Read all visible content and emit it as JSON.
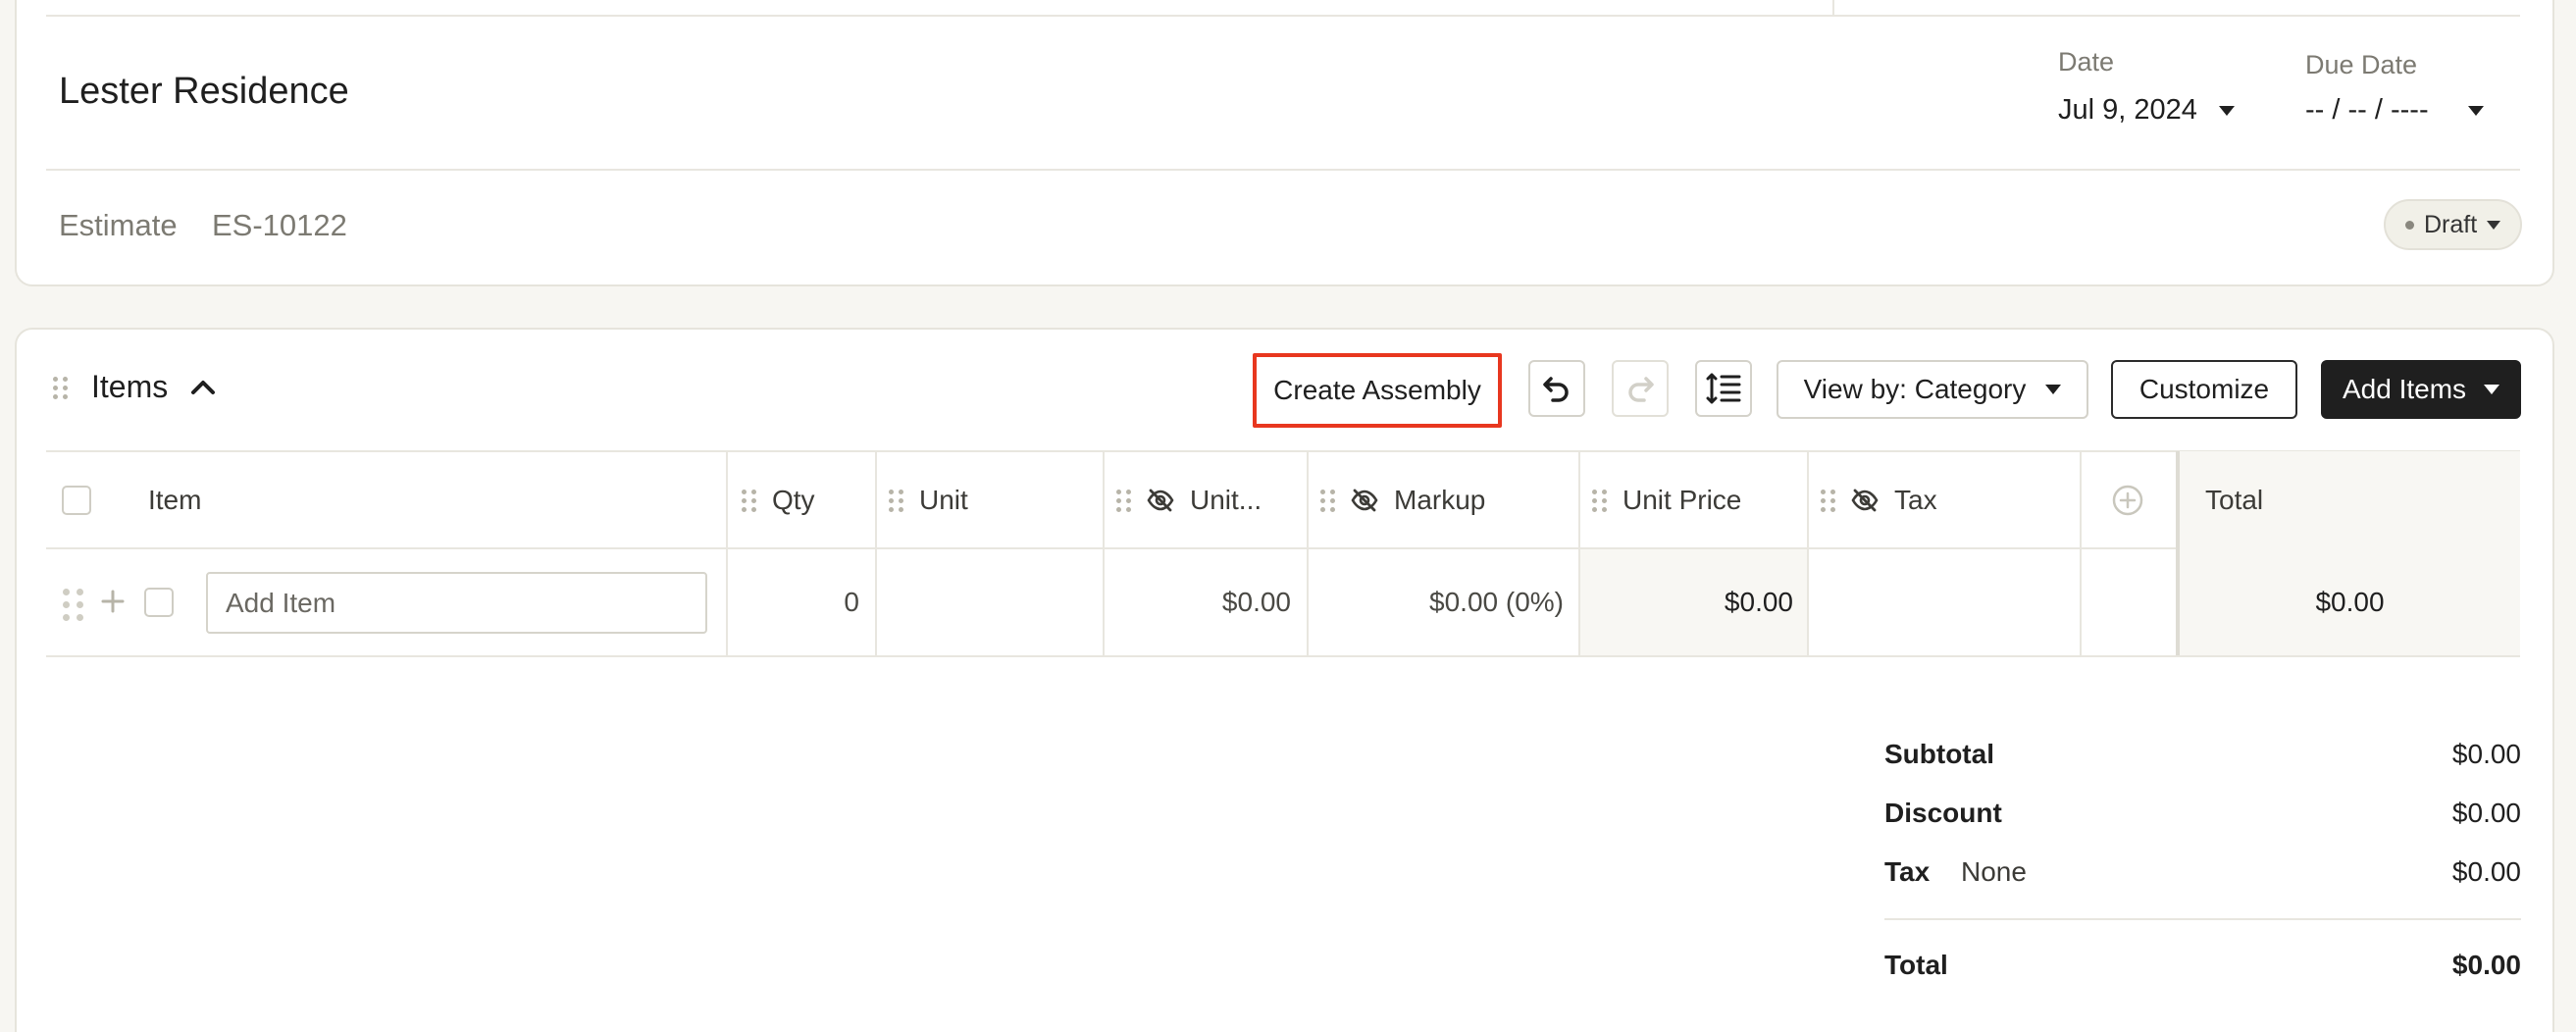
{
  "header": {
    "project_title": "Lester Residence",
    "date_label": "Date",
    "date_value": "Jul 9, 2024",
    "due_date_label": "Due Date",
    "due_date_value": "-- / -- / ----",
    "doc_type_label": "Estimate",
    "doc_number": "ES-10122",
    "status": "Draft"
  },
  "items_section": {
    "title": "Items",
    "create_assembly_label": "Create Assembly",
    "view_by_label": "View by: Category",
    "customize_label": "Customize",
    "add_items_label": "Add Items"
  },
  "table": {
    "columns": {
      "item": "Item",
      "qty": "Qty",
      "unit": "Unit",
      "unit_cost": "Unit...",
      "markup": "Markup",
      "unit_price": "Unit Price",
      "tax": "Tax",
      "total": "Total"
    },
    "new_row": {
      "placeholder": "Add Item",
      "qty": "0",
      "unit": "",
      "unit_cost": "$0.00",
      "markup": "$0.00 (0%)",
      "unit_price": "$0.00",
      "tax": "",
      "total": "$0.00"
    }
  },
  "totals": {
    "subtotal_label": "Subtotal",
    "subtotal_value": "$0.00",
    "discount_label": "Discount",
    "discount_value": "$0.00",
    "tax_label": "Tax",
    "tax_rate": "None",
    "tax_value": "$0.00",
    "total_label": "Total",
    "total_value": "$0.00"
  },
  "colors": {
    "highlight": "#e8371f",
    "dark_button": "#1f1f1f",
    "background": "#f7f6f2"
  }
}
